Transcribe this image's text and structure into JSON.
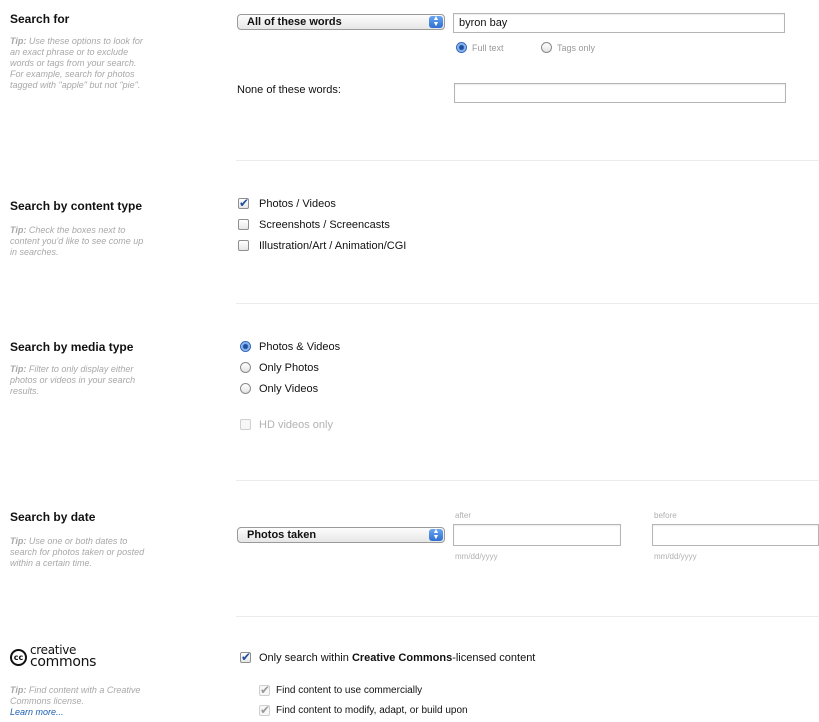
{
  "search_for": {
    "heading": "Search for",
    "tip_label": "Tip:",
    "tip_text": "Use these options to look for an exact phrase or to exclude words or tags from your search. For example, search for photos tagged with \"apple\" but not \"pie\".",
    "mode_select": "All of these words",
    "query_value": "byron bay",
    "scope_full": "Full text",
    "scope_tags": "Tags only",
    "none_label": "None of these words:",
    "none_value": ""
  },
  "content_type": {
    "heading": "Search by content type",
    "tip_label": "Tip:",
    "tip_text": "Check the boxes next to content you'd like to see come up in searches.",
    "options": [
      "Photos / Videos",
      "Screenshots / Screencasts",
      "Illustration/Art / Animation/CGI"
    ],
    "checked": [
      true,
      false,
      false
    ]
  },
  "media_type": {
    "heading": "Search by media type",
    "tip_label": "Tip:",
    "tip_text": "Filter to only display either photos or videos in your search results.",
    "options": [
      "Photos & Videos",
      "Only Photos",
      "Only Videos"
    ],
    "selected": 0,
    "hd_label": "HD videos only"
  },
  "date": {
    "heading": "Search by date",
    "tip_label": "Tip:",
    "tip_text": "Use one or both dates to search for photos taken or posted within a certain time.",
    "type_select": "Photos taken",
    "after_label": "after",
    "before_label": "before",
    "after_value": "",
    "before_value": "",
    "format_hint_after": "mm/dd/yyyy",
    "format_hint_before": "mm/dd/yyyy"
  },
  "creative_commons": {
    "logo_line1": "creative",
    "logo_line2": "commons",
    "logo_badge": "cc",
    "tip_label": "Tip:",
    "tip_text": "Find content with a Creative Commons license.",
    "learn_more": "Learn more...",
    "only_cc_prefix": "Only search within ",
    "only_cc_bold": "Creative Commons",
    "only_cc_suffix": "-licensed content",
    "commercial_label": "Find content to use commercially",
    "modify_label": "Find content to modify, adapt, or build upon"
  },
  "colors": {
    "accent": "#2f6fd0",
    "tip": "#a8a8a8",
    "link": "#1a5fb4"
  }
}
